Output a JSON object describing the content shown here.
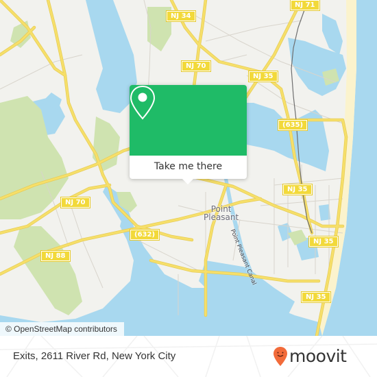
{
  "map": {
    "attribution": "© OpenStreetMap contributors",
    "place_labels": [
      {
        "id": "point-pleasant",
        "line1": "Point",
        "line2": "Pleasant"
      }
    ],
    "water_labels": [
      {
        "id": "point-pleasant-canal",
        "text": "Point Pleasant Canal"
      }
    ],
    "route_shields": [
      {
        "id": "nj-34",
        "text": "NJ 34"
      },
      {
        "id": "nj-71",
        "text": "NJ 71"
      },
      {
        "id": "nj-70-north",
        "text": "NJ 70"
      },
      {
        "id": "nj-35-north",
        "text": "NJ 35"
      },
      {
        "id": "cr-635",
        "text": "(635)"
      },
      {
        "id": "nj-70-west",
        "text": "NJ 70"
      },
      {
        "id": "nj-35-mid",
        "text": "NJ 35"
      },
      {
        "id": "cr-632",
        "text": "(632)"
      },
      {
        "id": "nj-88",
        "text": "NJ 88"
      },
      {
        "id": "nj-35-east",
        "text": "NJ 35"
      },
      {
        "id": "nj-35-south",
        "text": "NJ 35"
      }
    ],
    "colors": {
      "land": "#f2f2ee",
      "water": "#a8d8ef",
      "park": "#cfe3b0",
      "road_major": "#f6df6a",
      "road_minor": "#d8d4cc",
      "beach": "#fbf3cd",
      "rail": "#6e6e6e"
    }
  },
  "popup": {
    "icon": "location-pin-icon",
    "button_label": "Take me there",
    "accent_color": "#1fbb67"
  },
  "footer": {
    "address": "Exits, 2611 River Rd, New York City",
    "brand": "moovit",
    "brand_color": "#f26b3a"
  }
}
